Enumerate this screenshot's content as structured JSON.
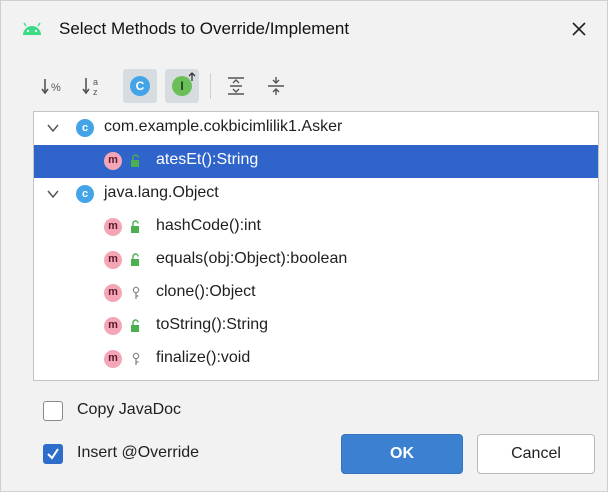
{
  "window": {
    "title": "Select Methods to Override/Implement",
    "title_icon": "android-icon",
    "close_icon": "close-icon"
  },
  "toolbar": {
    "buttons": [
      {
        "name": "sort-by-percent",
        "icon": "sort-percent-icon",
        "active": false
      },
      {
        "name": "sort-alphabetically",
        "icon": "sort-alpha-icon",
        "active": false
      },
      {
        "name": "show-classes",
        "icon": "class-icon",
        "label": "C",
        "active": true
      },
      {
        "name": "show-interfaces",
        "icon": "interface-icon",
        "label": "I",
        "active": true
      },
      {
        "name": "expand-all",
        "icon": "expand-all-icon",
        "active": false
      },
      {
        "name": "collapse-all",
        "icon": "collapse-all-icon",
        "active": false
      }
    ]
  },
  "tree": {
    "classes": [
      {
        "name": "com.example.cokbicimlilik1.Asker",
        "icon_letter": "c",
        "expanded": true,
        "methods": [
          {
            "label": "atesEt():String",
            "icon_letter": "m",
            "visibility": "public",
            "selected": true
          }
        ]
      },
      {
        "name": "java.lang.Object",
        "icon_letter": "c",
        "expanded": true,
        "methods": [
          {
            "label": "hashCode():int",
            "icon_letter": "m",
            "visibility": "public",
            "selected": false
          },
          {
            "label": "equals(obj:Object):boolean",
            "icon_letter": "m",
            "visibility": "public",
            "selected": false
          },
          {
            "label": "clone():Object",
            "icon_letter": "m",
            "visibility": "protected",
            "selected": false
          },
          {
            "label": "toString():String",
            "icon_letter": "m",
            "visibility": "public",
            "selected": false
          },
          {
            "label": "finalize():void",
            "icon_letter": "m",
            "visibility": "protected",
            "selected": false
          }
        ]
      }
    ]
  },
  "options": {
    "copy_javadoc": {
      "label": "Copy JavaDoc",
      "checked": false
    },
    "insert_override": {
      "label": "Insert @Override",
      "checked": true
    }
  },
  "buttons": {
    "ok": "OK",
    "cancel": "Cancel"
  },
  "colors": {
    "selection": "#2f65ca",
    "class_icon": "#44a4e8",
    "method_icon": "#f4a6b7",
    "public_lock": "#4caf50",
    "ok_button": "#3b80d1"
  }
}
